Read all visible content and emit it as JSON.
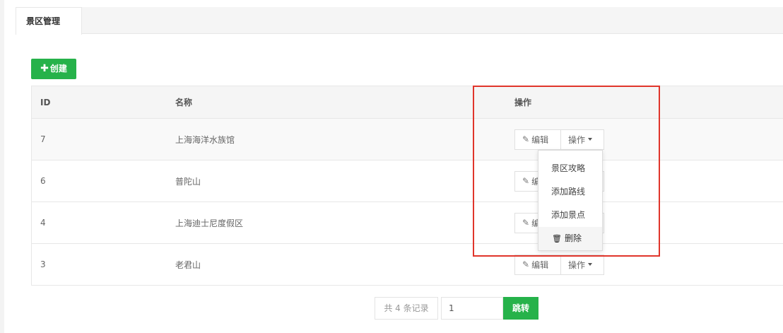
{
  "tab": {
    "label": "景区管理"
  },
  "toolbar": {
    "create_label": "创建"
  },
  "table": {
    "columns": {
      "id": "ID",
      "name": "名称",
      "op": "操作"
    },
    "rows": [
      {
        "id": "7",
        "name": "上海海洋水族馆"
      },
      {
        "id": "6",
        "name": "普陀山"
      },
      {
        "id": "4",
        "name": "上海迪士尼度假区"
      },
      {
        "id": "3",
        "name": "老君山"
      }
    ],
    "edit_label": "编辑",
    "op_label": "操作"
  },
  "dropdown": {
    "items": [
      "景区攻略",
      "添加路线",
      "添加景点"
    ],
    "delete_label": "删除"
  },
  "pager": {
    "count_text": "共 4 条记录",
    "page_value": "1",
    "go_label": "跳转"
  },
  "colors": {
    "accent": "#26b24a",
    "highlight": "#e0352b"
  },
  "icons": {
    "create": "plus-icon",
    "edit": "edit-icon",
    "dropdown": "caret-down-icon",
    "delete": "trash-icon"
  }
}
